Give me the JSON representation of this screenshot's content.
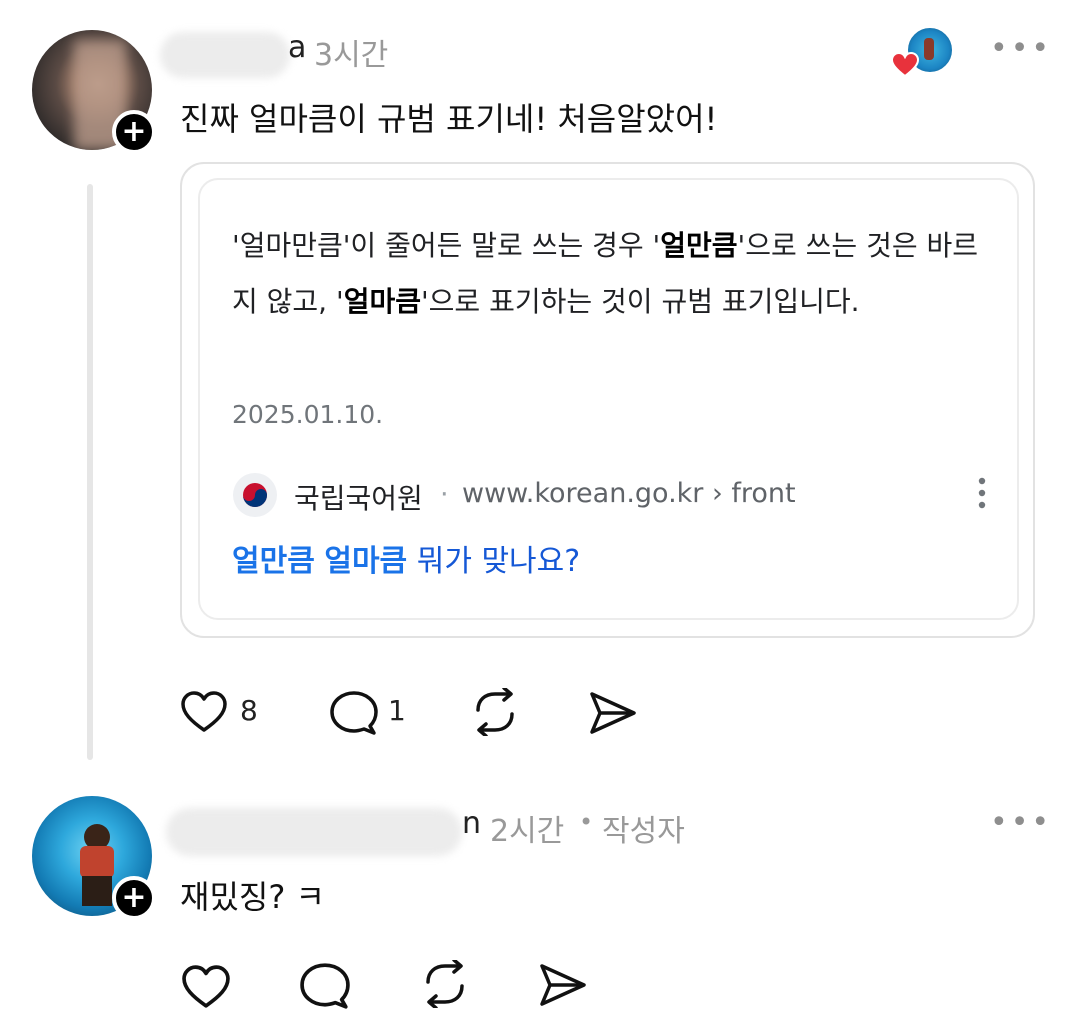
{
  "post": {
    "username_tail": "a",
    "time": "3시간",
    "text": "진짜 얼마큼이 규범 표기네! 처음알았어!",
    "menu_icon": "more-horizontal-icon",
    "card": {
      "snippet_pre": "'얼마만큼'이 줄어든 말로 쓰는 경우 '",
      "snippet_bold1": "얼만큼",
      "snippet_mid": "'으로 쓰는 것은 바르지 않고, '",
      "snippet_bold2": "얼마큼",
      "snippet_post": "'으로 표기하는 것이 규범 표기입니다.",
      "date": "2025.01.10.",
      "site_name": "국립국어원",
      "site_sep": "·",
      "site_url": "www.korean.go.kr › front",
      "link_bold1": "얼만큼",
      "link_bold2": "얼마큼",
      "link_rest": "뭐가 맞나요?"
    },
    "actions": {
      "like_count": "8",
      "comment_count": "1"
    }
  },
  "reply": {
    "username_tail": "n",
    "time": "2시간",
    "author_badge": "작성자",
    "sep": "•",
    "text": "재밌징? ㅋ"
  },
  "colors": {
    "heart_badge": "#e8323c",
    "link_blue": "#1a73e8"
  }
}
